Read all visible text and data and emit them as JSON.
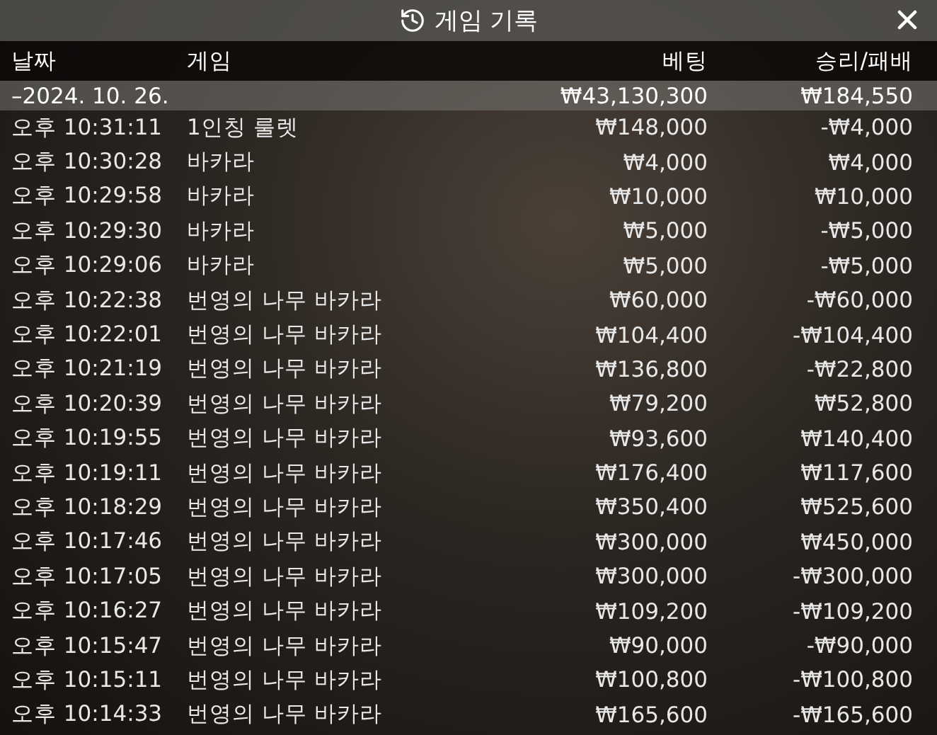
{
  "window": {
    "title": "게임 기록"
  },
  "table": {
    "columns": [
      "날짜",
      "게임",
      "베팅",
      "승리/패배"
    ],
    "groups": [
      {
        "date": "–2024. 10. 26.",
        "bet": "₩43,130,300",
        "result": "₩184,550",
        "rows": [
          {
            "time": "오후 10:31:11",
            "game": "1인칭 룰렛",
            "bet": "₩148,000",
            "result": "-₩4,000"
          },
          {
            "time": "오후 10:30:28",
            "game": "바카라",
            "bet": "₩4,000",
            "result": "₩4,000"
          },
          {
            "time": "오후 10:29:58",
            "game": "바카라",
            "bet": "₩10,000",
            "result": "₩10,000"
          },
          {
            "time": "오후 10:29:30",
            "game": "바카라",
            "bet": "₩5,000",
            "result": "-₩5,000"
          },
          {
            "time": "오후 10:29:06",
            "game": "바카라",
            "bet": "₩5,000",
            "result": "-₩5,000"
          },
          {
            "time": "오후 10:22:38",
            "game": "번영의 나무 바카라",
            "bet": "₩60,000",
            "result": "-₩60,000"
          },
          {
            "time": "오후 10:22:01",
            "game": "번영의 나무 바카라",
            "bet": "₩104,400",
            "result": "-₩104,400"
          },
          {
            "time": "오후 10:21:19",
            "game": "번영의 나무 바카라",
            "bet": "₩136,800",
            "result": "-₩22,800"
          },
          {
            "time": "오후 10:20:39",
            "game": "번영의 나무 바카라",
            "bet": "₩79,200",
            "result": "₩52,800"
          },
          {
            "time": "오후 10:19:55",
            "game": "번영의 나무 바카라",
            "bet": "₩93,600",
            "result": "₩140,400"
          },
          {
            "time": "오후 10:19:11",
            "game": "번영의 나무 바카라",
            "bet": "₩176,400",
            "result": "₩117,600"
          },
          {
            "time": "오후 10:18:29",
            "game": "번영의 나무 바카라",
            "bet": "₩350,400",
            "result": "₩525,600"
          },
          {
            "time": "오후 10:17:46",
            "game": "번영의 나무 바카라",
            "bet": "₩300,000",
            "result": "₩450,000"
          },
          {
            "time": "오후 10:17:05",
            "game": "번영의 나무 바카라",
            "bet": "₩300,000",
            "result": "-₩300,000"
          },
          {
            "time": "오후 10:16:27",
            "game": "번영의 나무 바카라",
            "bet": "₩109,200",
            "result": "-₩109,200"
          },
          {
            "time": "오후 10:15:47",
            "game": "번영의 나무 바카라",
            "bet": "₩90,000",
            "result": "-₩90,000"
          },
          {
            "time": "오후 10:15:11",
            "game": "번영의 나무 바카라",
            "bet": "₩100,800",
            "result": "-₩100,800"
          },
          {
            "time": "오후 10:14:33",
            "game": "번영의 나무 바카라",
            "bet": "₩165,600",
            "result": "-₩165,600"
          }
        ]
      }
    ]
  }
}
